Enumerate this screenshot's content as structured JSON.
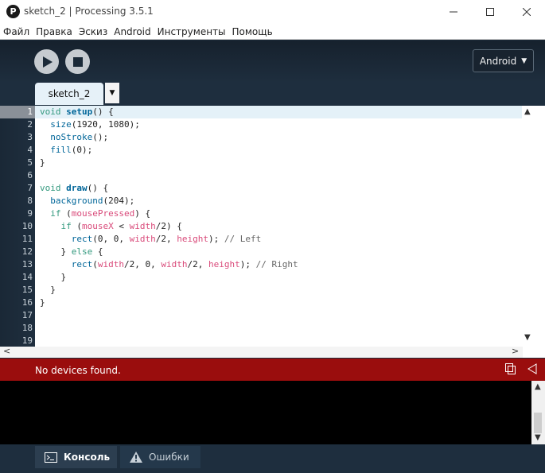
{
  "window": {
    "title": "sketch_2 | Processing 3.5.1",
    "app_icon_glyph": "P",
    "controls": {
      "minimize_icon": "minimize-icon",
      "maximize_icon": "maximize-icon",
      "close_icon": "close-icon"
    }
  },
  "menu": {
    "items": [
      "Файл",
      "Правка",
      "Эскиз",
      "Android",
      "Инструменты",
      "Помощь"
    ]
  },
  "toolbar": {
    "run_icon": "play-icon",
    "stop_icon": "stop-icon",
    "mode_label": "Android",
    "mode_arrow": "▼"
  },
  "tabs": {
    "active_tab": "sketch_2",
    "menu_arrow": "▼"
  },
  "editor": {
    "line_numbers": [
      "1",
      "2",
      "3",
      "4",
      "5",
      "6",
      "7",
      "8",
      "9",
      "10",
      "11",
      "12",
      "13",
      "14",
      "15",
      "16",
      "17",
      "18",
      "19"
    ],
    "active_line": 1,
    "code": [
      "void setup() {",
      "  size(1920, 1080);",
      "  noStroke();",
      "  fill(0);",
      "}",
      "",
      "void draw() {",
      "  background(204);",
      "  if (mousePressed) {",
      "    if (mouseX < width/2) {",
      "      rect(0, 0, width/2, height); // Left",
      "    } else {",
      "      rect(width/2, 0, width/2, height); // Right",
      "    }",
      "  }",
      "}",
      "",
      "",
      ""
    ]
  },
  "status": {
    "message": "No devices found.",
    "background": "#9a0d0d"
  },
  "footer": {
    "console_label": "Консоль",
    "errors_label": "Ошибки"
  },
  "colors": {
    "keyword": "#33997e",
    "function": "#006699",
    "variable": "#d94a7a",
    "comment": "#666666",
    "toolbar_bg": "#1e2e3e"
  }
}
